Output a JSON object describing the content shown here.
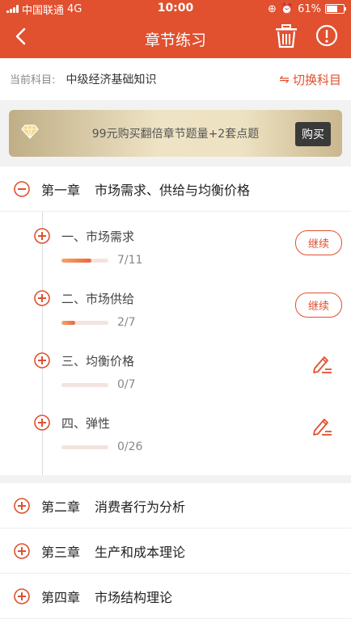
{
  "status_bar": {
    "carrier": "中国联通",
    "network": "4G",
    "time": "10:00",
    "battery": "61%"
  },
  "header": {
    "title": "章节练习"
  },
  "subject": {
    "label": "当前科目:",
    "value": "中级经济基础知识",
    "switch_label": "切换科目"
  },
  "banner": {
    "text": "99元购买翻倍章节题量+2套点题",
    "buy_label": "购买"
  },
  "chapters": [
    {
      "number": "第一章",
      "title": "市场需求、供给与均衡价格",
      "expanded": true
    },
    {
      "number": "第二章",
      "title": "消费者行为分析",
      "expanded": false
    },
    {
      "number": "第三章",
      "title": "生产和成本理论",
      "expanded": false
    },
    {
      "number": "第四章",
      "title": "市场结构理论",
      "expanded": false
    }
  ],
  "sections": [
    {
      "name": "一、市场需求",
      "progress": "7/11",
      "fraction": 0.636,
      "action": "继续"
    },
    {
      "name": "二、市场供给",
      "progress": "2/7",
      "fraction": 0.286,
      "action": "继续"
    },
    {
      "name": "三、均衡价格",
      "progress": "0/7",
      "fraction": 0,
      "action": "edit-icon"
    },
    {
      "name": "四、弹性",
      "progress": "0/26",
      "fraction": 0,
      "action": "edit-icon"
    }
  ],
  "colors": {
    "accent": "#e1502f"
  }
}
